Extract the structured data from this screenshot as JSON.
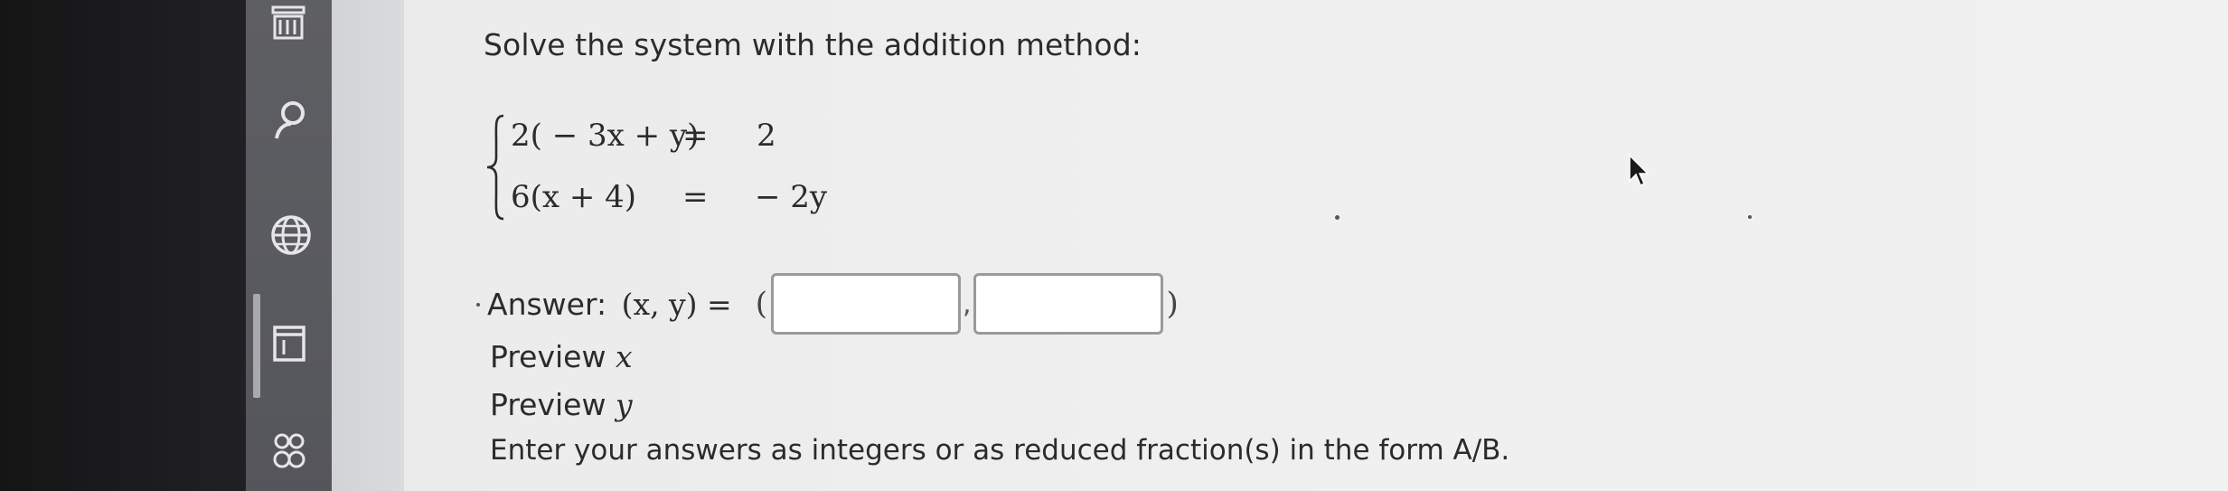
{
  "question": {
    "prompt": "Solve the system with the addition method:",
    "equations": [
      {
        "lhs": "2( − 3x + y)",
        "eq": "=",
        "rhs": "2"
      },
      {
        "lhs": "6(x + 4)",
        "eq": "=",
        "rhs": "− 2y"
      }
    ]
  },
  "answer": {
    "label": "Answer: ",
    "tuple": "(x, y) =",
    "open_paren": "(",
    "comma": ",",
    "close_paren": ")",
    "x_value": "",
    "y_value": ""
  },
  "preview": {
    "x_label": "Preview ",
    "x_var": "x",
    "y_label": "Preview ",
    "y_var": "y"
  },
  "instructions": "Enter your answers as integers or as reduced fraction(s) in the form A/B.",
  "sidebar": {
    "icons": [
      "grade-book-icon",
      "person-search-icon",
      "globe-icon",
      "assignment-icon",
      "group-icon"
    ]
  }
}
